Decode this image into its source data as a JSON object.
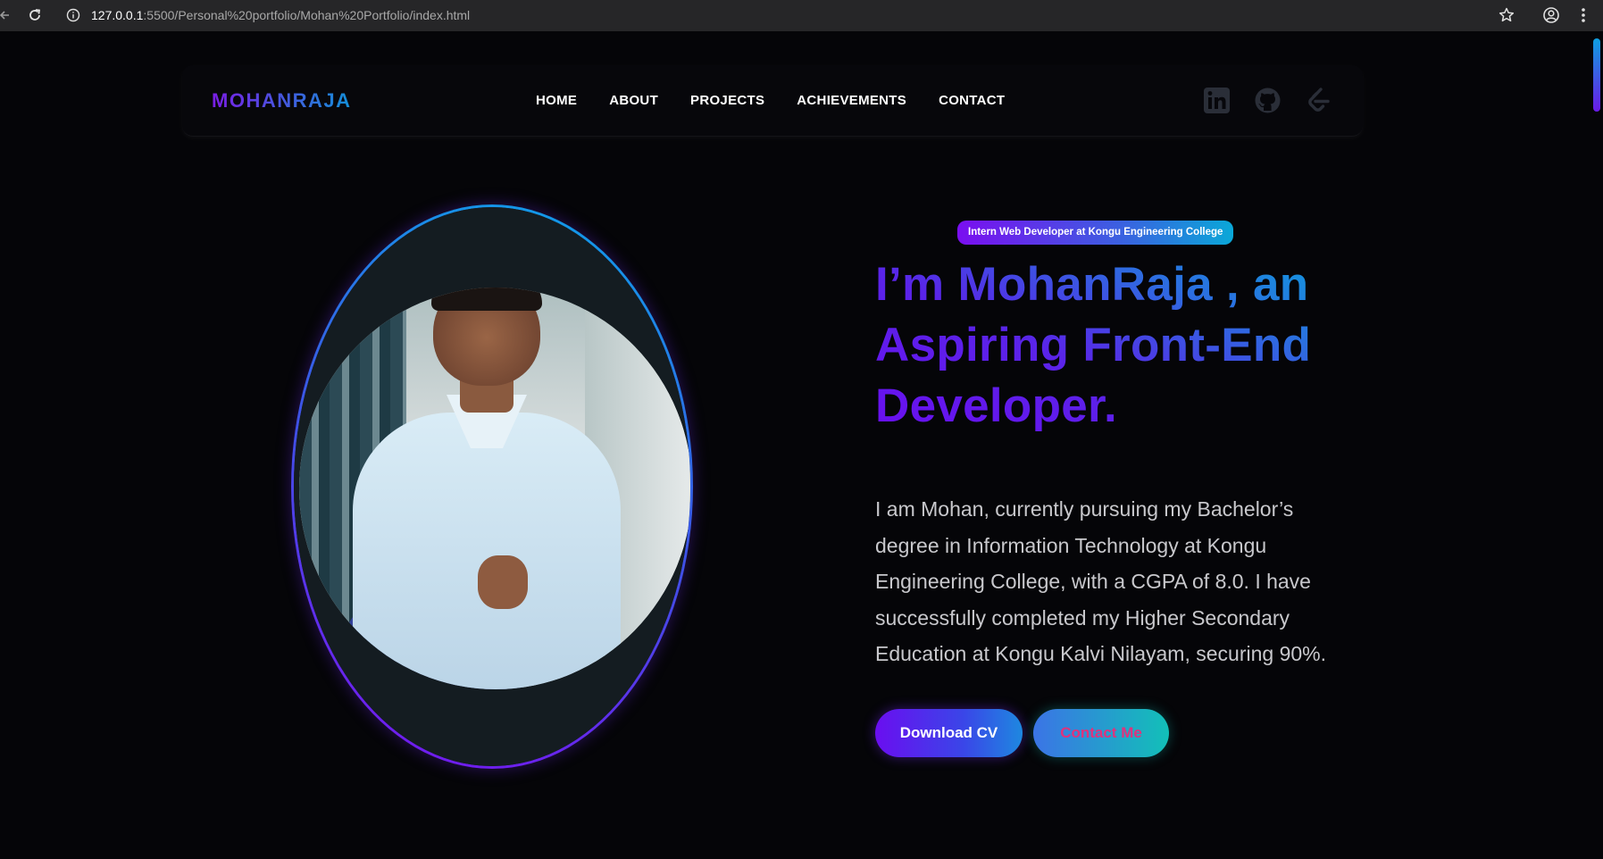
{
  "browser": {
    "url_host": "127.0.0.1",
    "url_path": ":5500/Personal%20portfolio/Mohan%20Portfolio/index.html",
    "icons": [
      "back-arrow-icon",
      "reload-icon",
      "site-info-icon",
      "bookmark-star-icon",
      "profile-icon",
      "kebab-menu-icon"
    ]
  },
  "navbar": {
    "logo": "MOHANRAJA",
    "links": [
      "HOME",
      "ABOUT",
      "PROJECTS",
      "ACHIEVEMENTS",
      "CONTACT"
    ],
    "social_icons": [
      "linkedin-icon",
      "github-icon",
      "leetcode-icon"
    ],
    "social_color": "#2a2e38"
  },
  "hero": {
    "badge": "Intern Web Developer at Kongu Engineering College",
    "headline": "I’m MohanRaja , an Aspiring Front-End Developer.",
    "bio": "I am Mohan, currently pursuing my Bachelor’s degree in Information Technology at Kongu Engineering College, with a CGPA of 8.0. I have successfully completed my Higher Secondary Education at Kongu Kalvi Nilayam, securing 90%.",
    "download_cv_label": "Download CV",
    "contact_me_label": "Contact Me"
  },
  "colors": {
    "background": "#050508",
    "accent_purple": "#6a0ef0",
    "accent_blue": "#08a6dc",
    "contact_text": "#e0327c"
  }
}
